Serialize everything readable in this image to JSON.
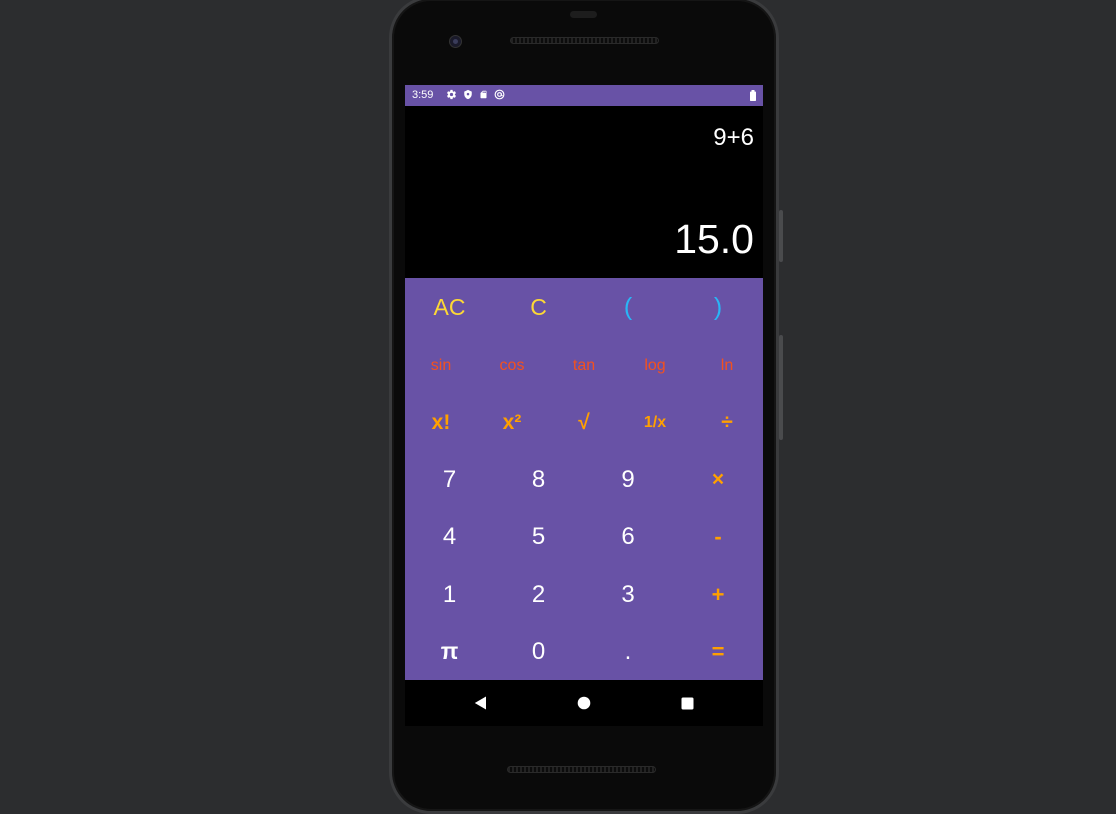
{
  "status_bar": {
    "time": "3:59",
    "icons": [
      "settings-icon",
      "shield-icon",
      "sd-card-icon",
      "at-sign-icon"
    ],
    "battery_icon": "battery-icon"
  },
  "display": {
    "expression": "9+6",
    "result": "15.0"
  },
  "keypad": {
    "row1": [
      "AC",
      "C",
      "(",
      ")"
    ],
    "row2": [
      "sin",
      "cos",
      "tan",
      "log",
      "ln"
    ],
    "row3": [
      "x!",
      "x²",
      "√",
      "1/x",
      "÷"
    ],
    "row4": [
      "7",
      "8",
      "9",
      "×"
    ],
    "row5": [
      "4",
      "5",
      "6",
      "-"
    ],
    "row6": [
      "1",
      "2",
      "3",
      "+"
    ],
    "row7": [
      "π",
      "0",
      ".",
      "="
    ]
  },
  "nav_bar": {
    "buttons": [
      "back-icon",
      "home-icon",
      "recents-icon"
    ]
  },
  "colors": {
    "primary": "#6852a6",
    "clear_keys": "#fdd835",
    "paren_keys": "#29b6f6",
    "function_keys": "#f4511e",
    "operator_keys": "#ffa000",
    "digit_keys": "#ffffff",
    "background": "#2c2d2f"
  }
}
